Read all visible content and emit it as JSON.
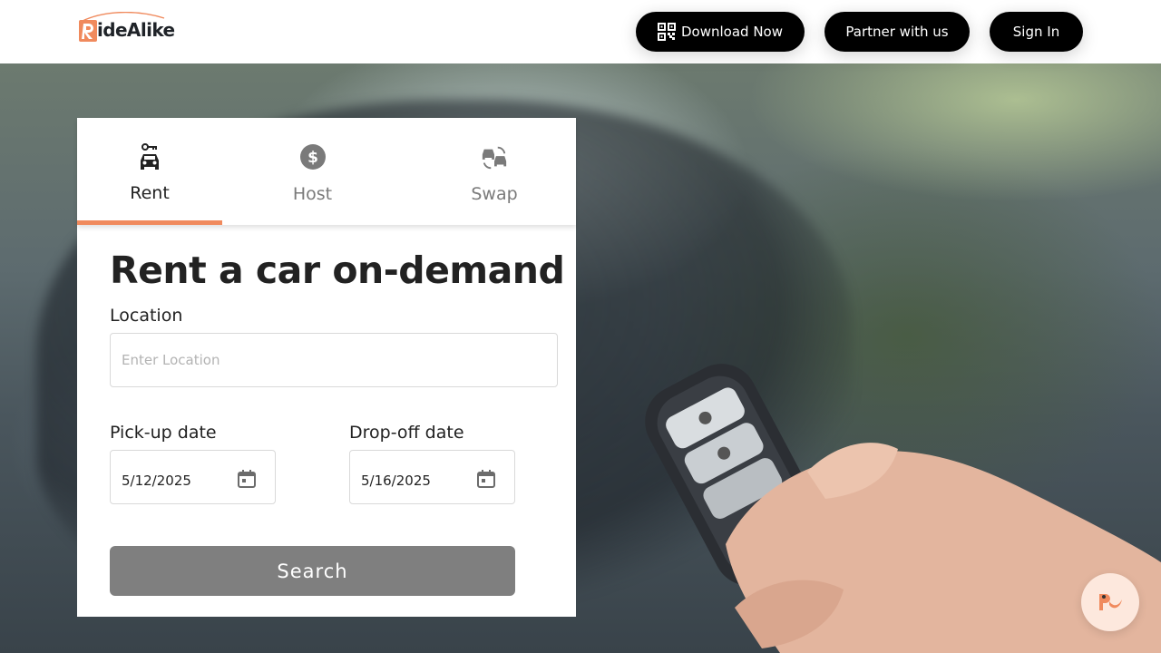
{
  "brand": {
    "logo_text": "ideAlike",
    "logo_letter": "R",
    "accent_color": "#f08a5d"
  },
  "header": {
    "download_label": "Download Now",
    "download_icon": "qr-code-icon",
    "partner_label": "Partner with us",
    "signin_label": "Sign In"
  },
  "tabs": [
    {
      "label": "Rent",
      "icon": "car-key-icon",
      "active": true
    },
    {
      "label": "Host",
      "icon": "dollar-coin-icon",
      "active": false
    },
    {
      "label": "Swap",
      "icon": "car-swap-icon",
      "active": false
    }
  ],
  "form": {
    "heading": "Rent a car on-demand",
    "location_label": "Location",
    "location_placeholder": "Enter Location",
    "location_value": "",
    "pickup_label": "Pick-up date",
    "pickup_value": "5/12/2025",
    "dropoff_label": "Drop-off date",
    "dropoff_value": "5/16/2025",
    "calendar_icon": "calendar-icon",
    "search_label": "Search"
  },
  "chat": {
    "icon": "chat-assistant-icon"
  }
}
